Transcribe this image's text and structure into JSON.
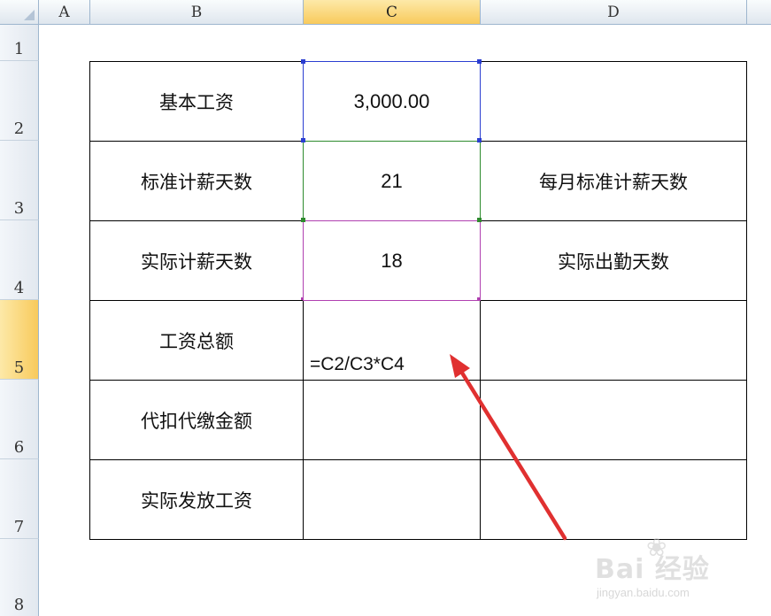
{
  "columns": [
    "A",
    "B",
    "C",
    "D"
  ],
  "rows": [
    "1",
    "2",
    "3",
    "4",
    "5",
    "6",
    "7",
    "8"
  ],
  "cells": {
    "B2": "基本工资",
    "C2": "3,000.00",
    "B3": "标准计薪天数",
    "C3": "21",
    "D3": "每月标准计薪天数",
    "B4": "实际计薪天数",
    "C4": "18",
    "D4": "实际出勤天数",
    "B5": "工资总额",
    "B6": "代扣代缴金额",
    "B7": "实际发放工资"
  },
  "formula_text": "=C2/C3*C4",
  "selected": {
    "column": "C",
    "row": "5"
  },
  "reference_colors": {
    "C2": "#2b3ed1",
    "C3": "#2e8b2e",
    "C4": "#b040b0",
    "arrow": "#e03030"
  },
  "watermark": {
    "brand": "Bai   经验",
    "url": "jingyan.baidu.com"
  }
}
